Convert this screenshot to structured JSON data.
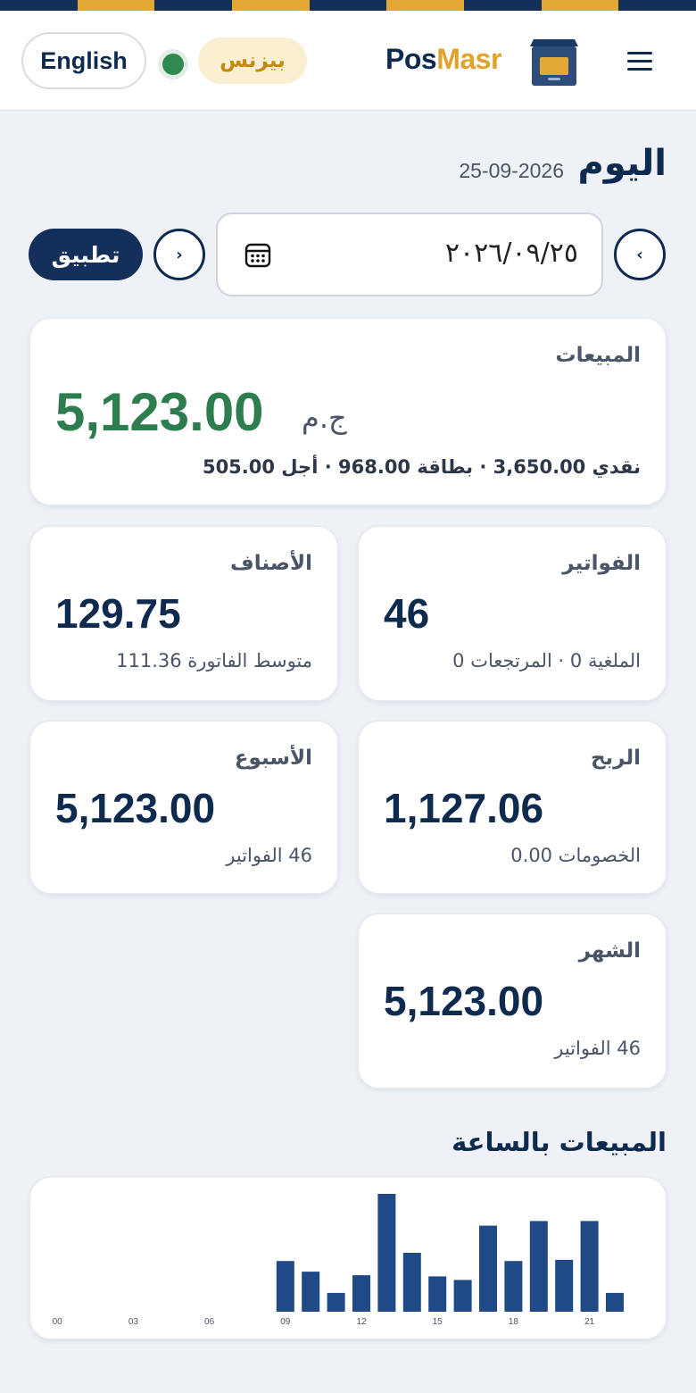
{
  "header": {
    "language_button": "English",
    "plan_badge": "بيزنس",
    "brand_part1": "Pos",
    "brand_part2": "Masr",
    "stripe_colors": [
      "#132f5a",
      "#e3a833"
    ]
  },
  "page": {
    "title": "اليوم",
    "date": "25-09-2026"
  },
  "date_picker": {
    "value": "٢٠٢٦/٠٩/٢٥",
    "apply_label": "تطبيق",
    "prev_icon": "chevron-left-icon",
    "next_icon": "chevron-right-icon"
  },
  "sales_card": {
    "label": "المبيعات",
    "currency": "ج.م",
    "value": "5,123.00",
    "breakdown": "نقدي 3,650.00 · بطاقة 968.00 · أجل 505.00"
  },
  "stats": {
    "invoices": {
      "label": "الفواتير",
      "value": "46",
      "sub": "الملغية 0 · المرتجعات 0"
    },
    "items": {
      "label": "الأصناف",
      "value": "129.75",
      "sub": "متوسط الفاتورة 111.36"
    },
    "profit": {
      "label": "الربح",
      "value": "1,127.06",
      "sub": "الخصومات 0.00"
    },
    "week": {
      "label": "الأسبوع",
      "value": "5,123.00",
      "sub": "46 الفواتير"
    },
    "month": {
      "label": "الشهر",
      "value": "5,123.00",
      "sub": "46 الفواتير"
    }
  },
  "hourly_sales": {
    "title": "المبيعات بالساعة"
  },
  "chart_data": {
    "type": "bar",
    "categories": [
      "00",
      "01",
      "02",
      "03",
      "04",
      "05",
      "06",
      "07",
      "08",
      "09",
      "10",
      "11",
      "12",
      "13",
      "14",
      "15",
      "16",
      "17",
      "18",
      "19",
      "20",
      "21",
      "22",
      "23"
    ],
    "values": [
      0,
      0,
      0,
      0,
      0,
      0,
      0,
      0,
      0,
      43,
      34,
      16,
      31,
      100,
      50,
      30,
      27,
      73,
      43,
      77,
      44,
      77,
      16,
      0
    ],
    "tick_labels": [
      "00",
      "03",
      "06",
      "09",
      "12",
      "15",
      "18",
      "21"
    ],
    "bar_color": "#1f4a85",
    "grid": false
  }
}
